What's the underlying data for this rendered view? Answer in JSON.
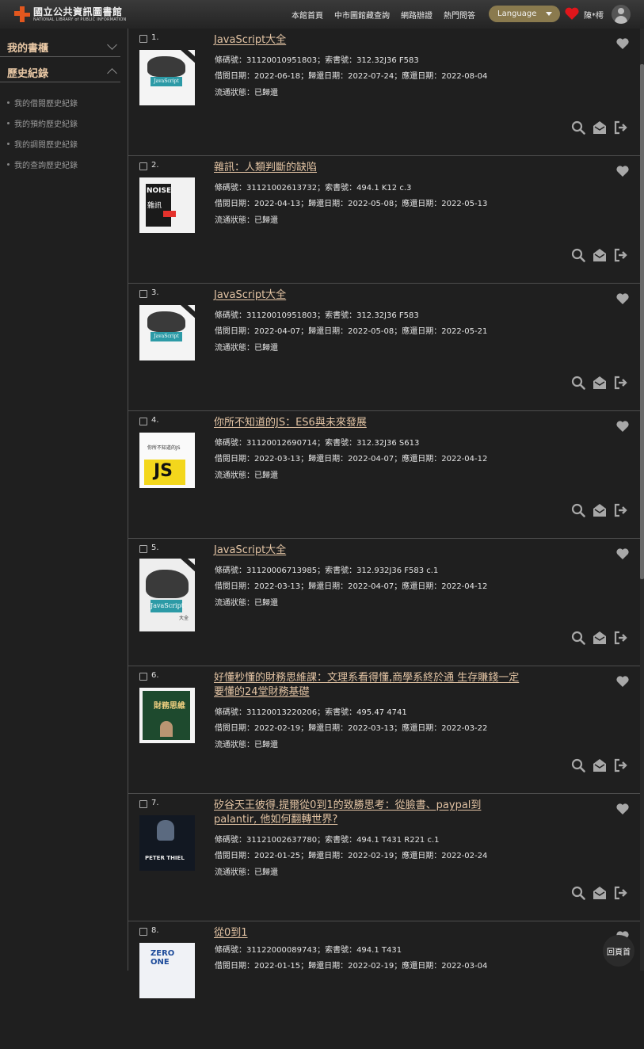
{
  "header": {
    "logo_cn": "國立公共資訊圖書館",
    "logo_en": "NATIONAL LIBRARY of PUBLIC INFORMATION",
    "nav": [
      "本館首頁",
      "中市圖館藏查詢",
      "網路辦證",
      "熱門問答"
    ],
    "language_label": "Language",
    "user_name": "陳*樗"
  },
  "sidebar": {
    "sections": [
      {
        "label": "我的書櫃"
      },
      {
        "label": "歷史紀錄"
      }
    ],
    "items": [
      "我的借閱歷史紀錄",
      "我的預約歷史紀錄",
      "我的調閱歷史紀錄",
      "我的查詢歷史紀錄"
    ]
  },
  "records": [
    {
      "num": "1.",
      "title": "JavaScript大全",
      "barcode": "條碼號：31120010951803；索書號：312.32J36 F583",
      "dates": "借閱日期：2022-06-18；歸還日期：2022-07-24；應還日期：2022-08-04",
      "status": "流通狀態：已歸還"
    },
    {
      "num": "2.",
      "title": "雜訊：人類判斷的缺陷",
      "barcode": "條碼號：31121002613732；索書號：494.1 K12 c.3",
      "dates": "借閱日期：2022-04-13；歸還日期：2022-05-08；應還日期：2022-05-13",
      "status": "流通狀態：已歸還"
    },
    {
      "num": "3.",
      "title": "JavaScript大全",
      "barcode": "條碼號：31120010951803；索書號：312.32J36 F583",
      "dates": "借閱日期：2022-04-07；歸還日期：2022-05-08；應還日期：2022-05-21",
      "status": "流通狀態：已歸還"
    },
    {
      "num": "4.",
      "title": "你所不知道的JS：ES6與未來發展",
      "barcode": "條碼號：31120012690714；索書號：312.32J36 S613",
      "dates": "借閱日期：2022-03-13；歸還日期：2022-04-07；應還日期：2022-04-12",
      "status": "流通狀態：已歸還"
    },
    {
      "num": "5.",
      "title": "JavaScript大全",
      "barcode": "條碼號：31120006713985；索書號：312.932J36 F583 c.1",
      "dates": "借閱日期：2022-03-13；歸還日期：2022-04-07；應還日期：2022-04-12",
      "status": "流通狀態：已歸還"
    },
    {
      "num": "6.",
      "title": "好懂秒懂的財務思維課：文理系看得懂,商學系終於通 生存賺錢一定要懂的24堂財務基礎",
      "barcode": "條碼號：31120013220206；索書號：495.47 4741",
      "dates": "借閱日期：2022-02-19；歸還日期：2022-03-13；應還日期：2022-03-22",
      "status": "流通狀態：已歸還"
    },
    {
      "num": "7.",
      "title": "矽谷天王彼得.提爾從0到1的致勝思考：從臉書、paypal到palantir, 他如何翻轉世界?",
      "barcode": "條碼號：31121002637780；索書號：494.1 T431 R221 c.1",
      "dates": "借閱日期：2022-01-25；歸還日期：2022-02-19；應還日期：2022-02-24",
      "status": "流通狀態：已歸還"
    },
    {
      "num": "8.",
      "title": "從0到1",
      "barcode": "條碼號：31122000089743；索書號：494.1 T431",
      "dates": "借閱日期：2022-01-15；歸還日期：2022-02-19；應還日期：2022-03-04",
      "status": ""
    }
  ],
  "covers": {
    "js_label": "JavaScript",
    "js_sub": "大全",
    "noise": "NOISE",
    "noise_cn": "雜訊",
    "ydkjs": "JS",
    "ydkjs_cn": "你所不知道的JS",
    "fin": "財務思維",
    "thiel": "PETER THIEL",
    "zero_one": "ZERO ONE"
  },
  "back_to_top": "回頁首",
  "colors": {
    "accent": "#e3c4a4",
    "heart_red": "#e0161b",
    "logo": "#e2571e"
  }
}
